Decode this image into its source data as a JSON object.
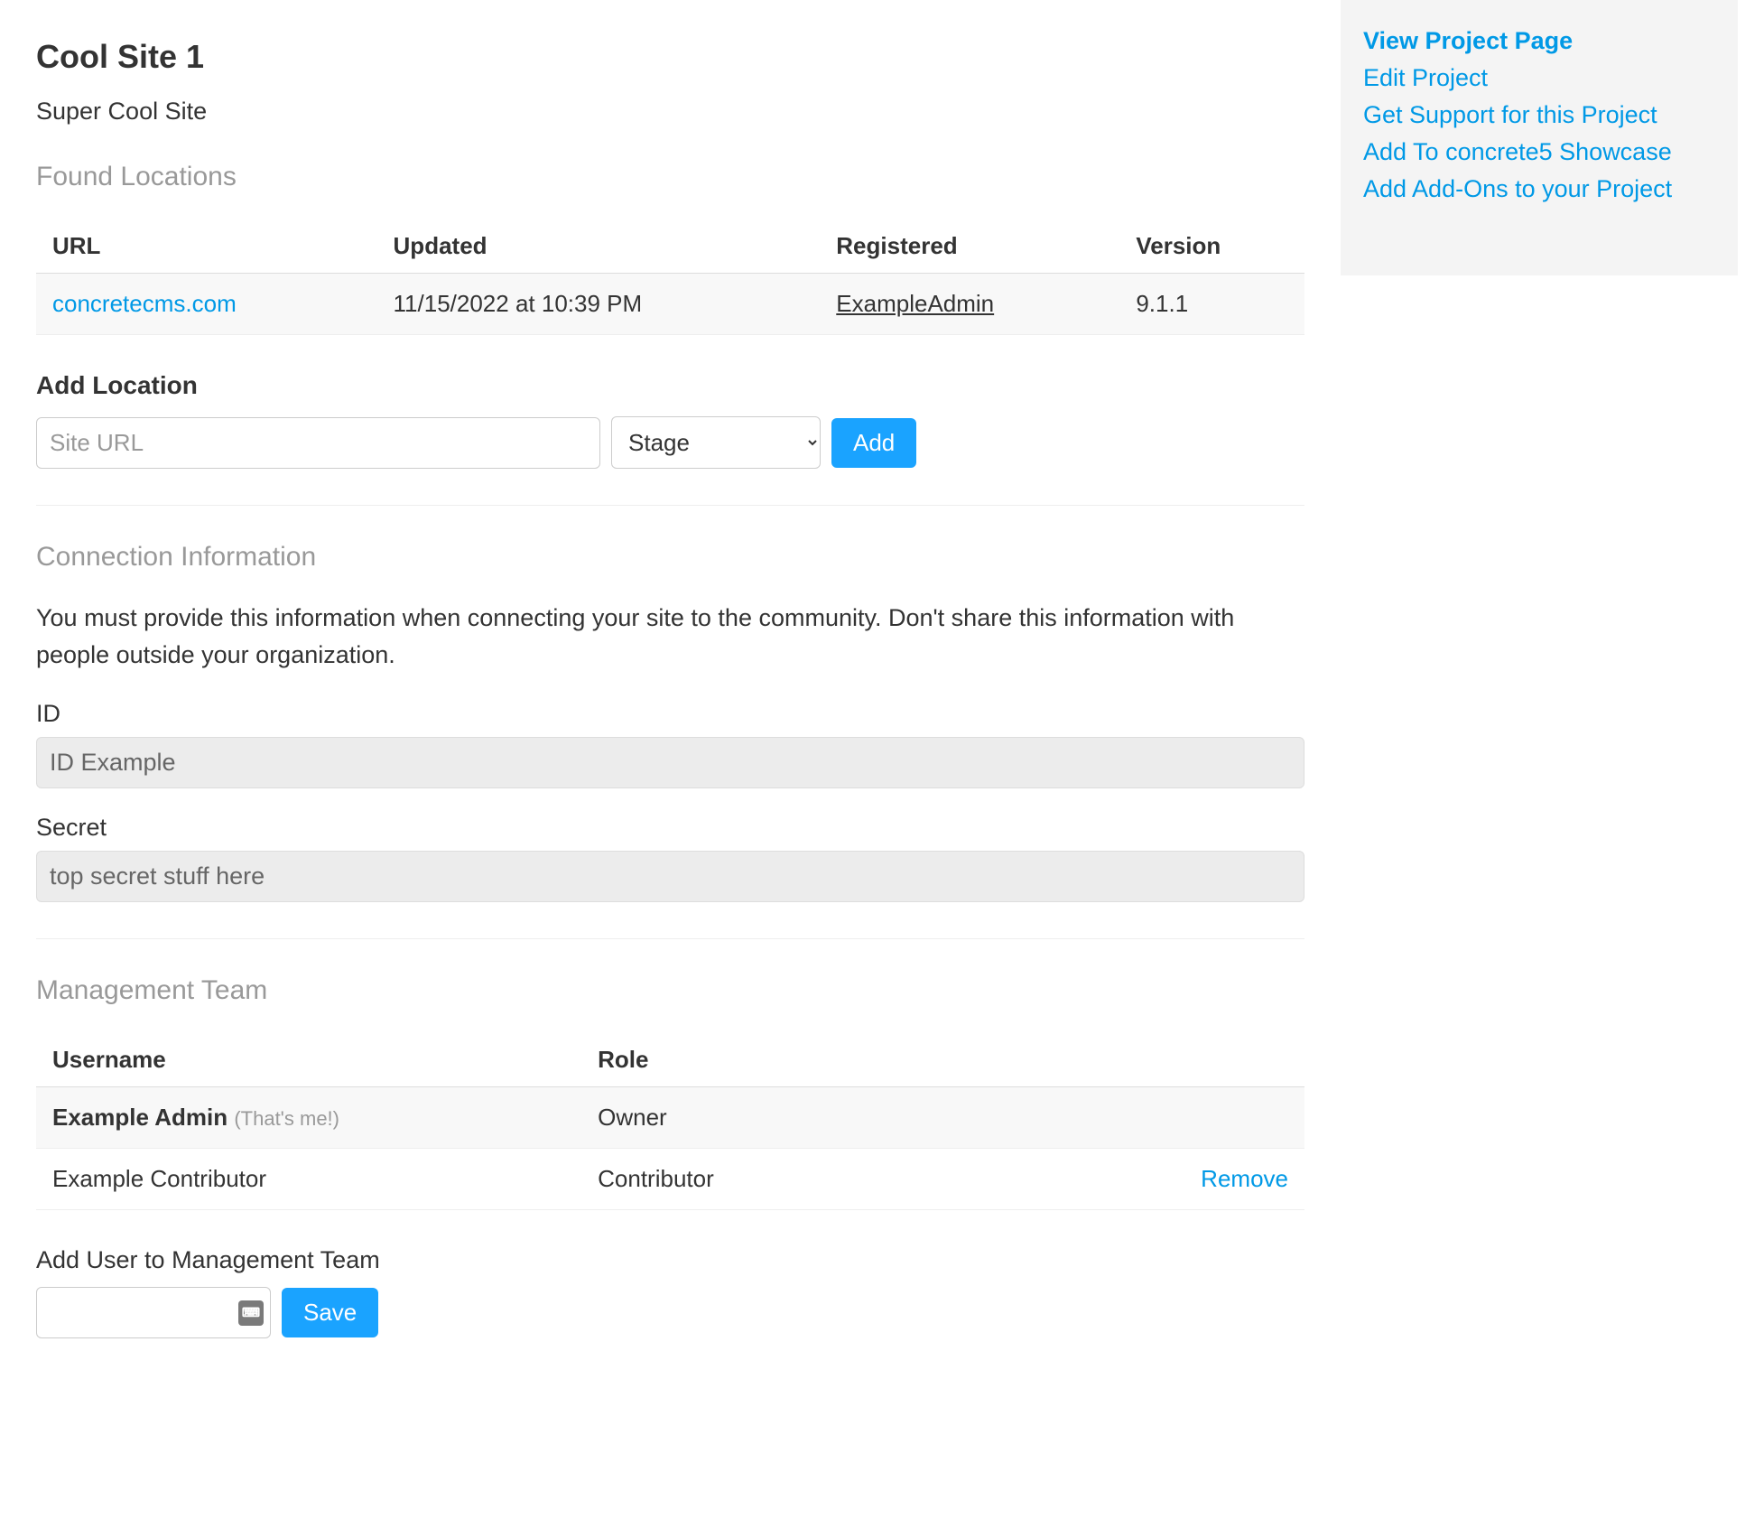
{
  "header": {
    "title": "Cool Site 1",
    "subtitle": "Super Cool Site"
  },
  "found_locations": {
    "heading": "Found Locations",
    "columns": [
      "URL",
      "Updated",
      "Registered",
      "Version"
    ],
    "rows": [
      {
        "url": "concretecms.com",
        "updated": "11/15/2022 at 10:39 PM",
        "registered": "ExampleAdmin",
        "version": "9.1.1"
      }
    ]
  },
  "add_location": {
    "heading": "Add Location",
    "placeholder": "Site URL",
    "stage_selected": "Stage",
    "add_button": "Add"
  },
  "connection": {
    "heading": "Connection Information",
    "help": "You must provide this information when connecting your site to the community. Don't share this information with people outside your organization.",
    "id_label": "ID",
    "id_value": "ID Example",
    "secret_label": "Secret",
    "secret_value": "top secret stuff here"
  },
  "team": {
    "heading": "Management Team",
    "columns": [
      "Username",
      "Role",
      ""
    ],
    "rows": [
      {
        "username": "Example Admin",
        "me": "(That's me!)",
        "role": "Owner",
        "action": ""
      },
      {
        "username": "Example Contributor",
        "me": "",
        "role": "Contributor",
        "action": "Remove"
      }
    ],
    "add_label": "Add User to Management Team",
    "save_button": "Save"
  },
  "sidebar": {
    "links": [
      "View Project Page",
      "Edit Project",
      "Get Support for this Project",
      "Add To concrete5 Showcase",
      "Add Add-Ons to your Project"
    ]
  }
}
